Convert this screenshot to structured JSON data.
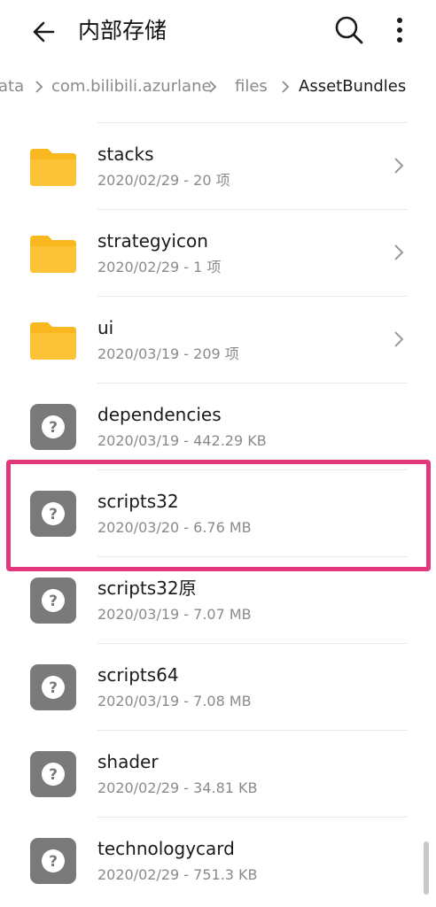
{
  "header": {
    "title": "内部存储"
  },
  "breadcrumbs": [
    "ata",
    "com.bilibili.azurlane",
    "files",
    "AssetBundles"
  ],
  "items": [
    {
      "name": "stacks",
      "meta": "2020/02/29 - 20 项",
      "type": "folder"
    },
    {
      "name": "strategyicon",
      "meta": "2020/02/29 - 1 项",
      "type": "folder"
    },
    {
      "name": "ui",
      "meta": "2020/03/19 - 209 项",
      "type": "folder"
    },
    {
      "name": "dependencies",
      "meta": "2020/03/19 - 442.29 KB",
      "type": "file"
    },
    {
      "name": "scripts32",
      "meta": "2020/03/20 - 6.76 MB",
      "type": "file"
    },
    {
      "name": "scripts32原",
      "meta": "2020/03/19 - 7.07 MB",
      "type": "file"
    },
    {
      "name": "scripts64",
      "meta": "2020/03/19 - 7.08 MB",
      "type": "file"
    },
    {
      "name": "shader",
      "meta": "2020/02/29 - 34.81 KB",
      "type": "file"
    },
    {
      "name": "technologycard",
      "meta": "2020/02/29 - 751.3 KB",
      "type": "file"
    }
  ],
  "icons": {
    "back": "arrow-left-icon",
    "search": "search-icon",
    "more": "more-vertical-icon",
    "folder": "folder-icon",
    "unknown_file": "unknown-file-icon",
    "chevron": "chevron-right-icon"
  },
  "colors": {
    "folder": "#f9b820",
    "unknown_file": "#7a7a7a",
    "highlight": "#e0387a"
  }
}
